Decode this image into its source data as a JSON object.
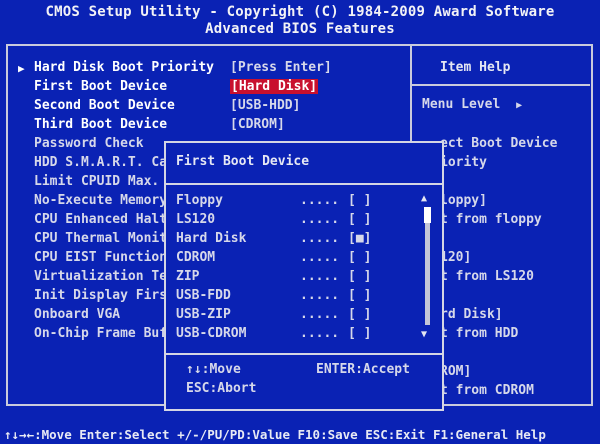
{
  "header": {
    "title": "CMOS Setup Utility - Copyright (C) 1984-2009 Award Software",
    "subtitle": "Advanced BIOS Features"
  },
  "settings": [
    {
      "label": "Hard Disk Boot Priority",
      "value": "[Press Enter]",
      "submenu": true
    },
    {
      "label": "First Boot Device",
      "value": "[Hard Disk]",
      "selected": true
    },
    {
      "label": "Second Boot Device",
      "value": "[USB-HDD]"
    },
    {
      "label": "Third Boot Device",
      "value": "[CDROM]"
    },
    {
      "label": "Password Check",
      "value": ""
    },
    {
      "label": "HDD S.M.A.R.T. Ca",
      "value": ""
    },
    {
      "label": "Limit CPUID Max.",
      "value": ""
    },
    {
      "label": "No-Execute Memory",
      "value": ""
    },
    {
      "label": "CPU Enhanced Halt",
      "value": ""
    },
    {
      "label": "CPU Thermal Monit",
      "value": ""
    },
    {
      "label": "CPU EIST Function",
      "value": ""
    },
    {
      "label": "Virtualization Te",
      "value": ""
    },
    {
      "label": "Init Display Firs",
      "value": ""
    },
    {
      "label": "Onboard VGA",
      "value": ""
    },
    {
      "label": "On-Chip Frame Buf",
      "value": ""
    }
  ],
  "help": {
    "title": "Item Help",
    "menu_level": "Menu Level",
    "menu_level_arrow": "▶",
    "lines": [
      "ect Boot Device",
      "iority",
      "",
      "loppy]",
      "t from floppy",
      "",
      "120]",
      "t from LS120",
      "",
      "rd Disk]",
      "t from HDD",
      "",
      "ROM]",
      "t from CDROM"
    ]
  },
  "popup": {
    "title": "First Boot Device",
    "options": [
      {
        "label": "Floppy",
        "dots": ".....",
        "box": "[ ]"
      },
      {
        "label": "LS120",
        "dots": ".....",
        "box": "[ ]"
      },
      {
        "label": "Hard Disk",
        "dots": ".....",
        "box": "[■]",
        "checked": true
      },
      {
        "label": "CDROM",
        "dots": ".....",
        "box": "[ ]"
      },
      {
        "label": "ZIP",
        "dots": ".....",
        "box": "[ ]"
      },
      {
        "label": "USB-FDD",
        "dots": ".....",
        "box": "[ ]"
      },
      {
        "label": "USB-ZIP",
        "dots": ".....",
        "box": "[ ]"
      },
      {
        "label": "USB-CDROM",
        "dots": ".....",
        "box": "[ ]"
      }
    ],
    "scroll_up": "▲",
    "scroll_down": "▼",
    "move": "↑↓:Move",
    "accept": "ENTER:Accept",
    "abort": "ESC:Abort"
  },
  "footer": "↑↓→←:Move  Enter:Select  +/-/PU/PD:Value  F10:Save  ESC:Exit  F1:General Help",
  "colors": {
    "background": "#0a22b4",
    "highlight": "#c8102e",
    "text": "#d6d8ea"
  }
}
